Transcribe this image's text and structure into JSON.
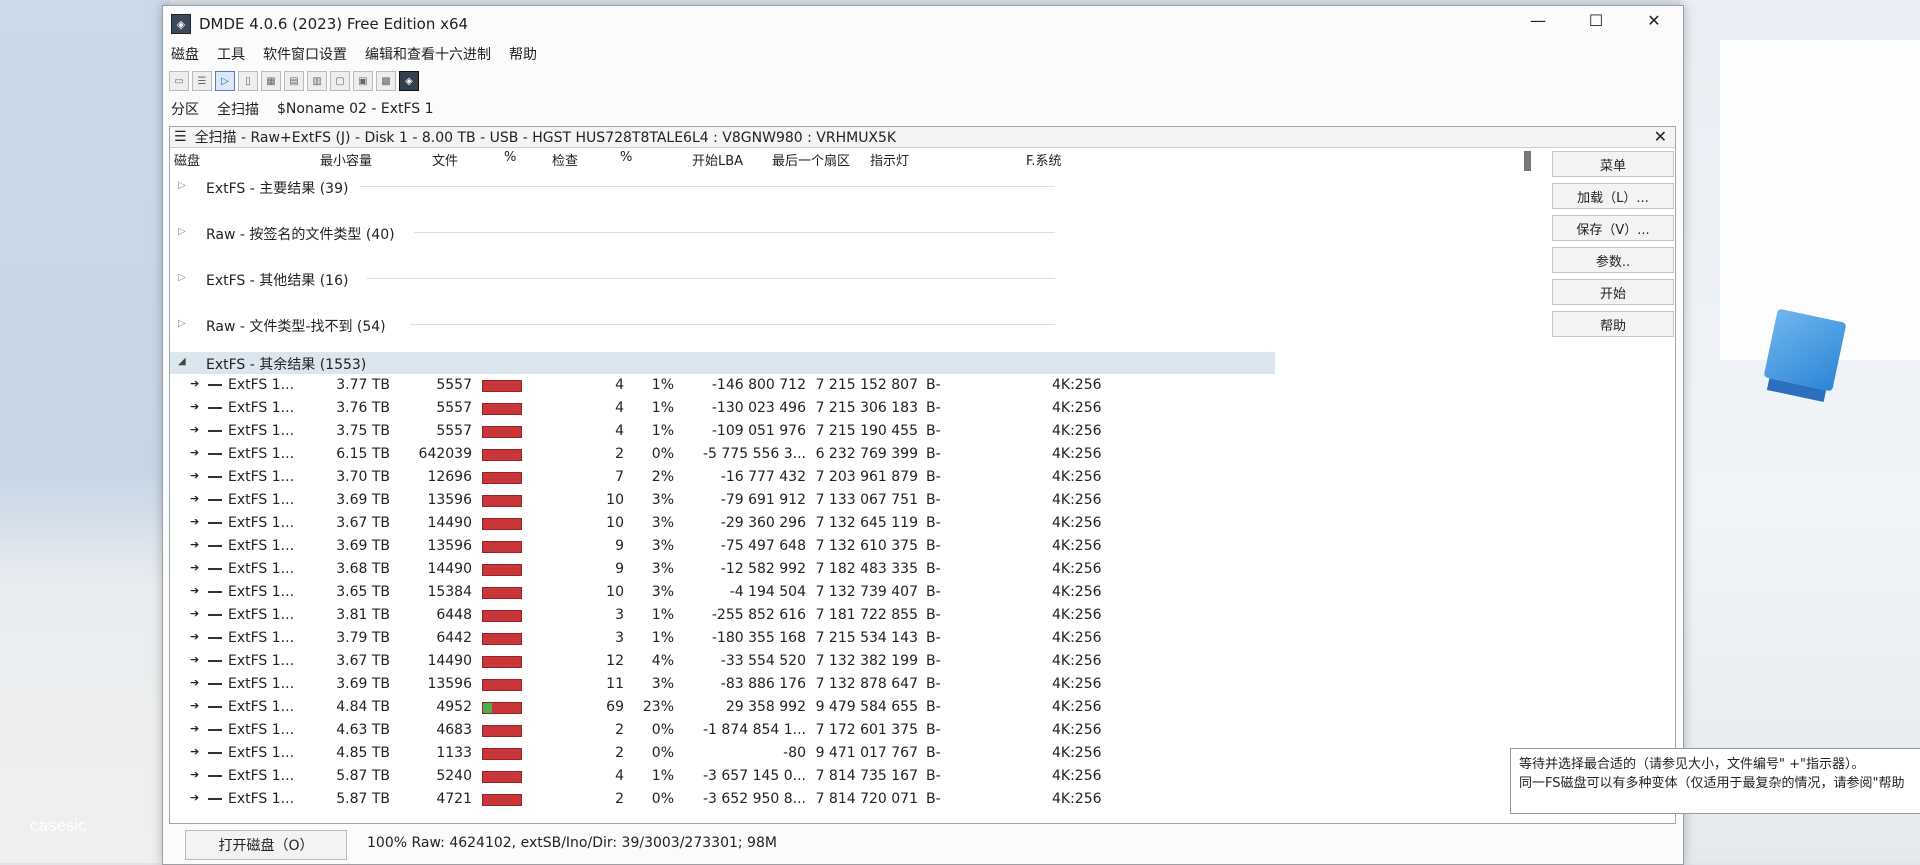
{
  "window": {
    "title": "DMDE 4.0.6 (2023) Free Edition x64",
    "app_icon": "dmde-logo-icon"
  },
  "menu": [
    "磁盘",
    "工具",
    "软件窗口设置",
    "编辑和查看十六进制",
    "帮助"
  ],
  "breadcrumb": {
    "partition_label": "分区",
    "scan_label": "全扫描",
    "volume": "$Noname 02 - ExtFS 1"
  },
  "panel": {
    "title": "全扫描 - Raw+ExtFS (J) - Disk 1 - 8.00 TB - USB - HGST HUS728T8TALE6L4 : V8GNW980 : VRHMUX5K"
  },
  "columns": {
    "disk": "磁盘",
    "min_size": "最小容量",
    "files": "文件",
    "pct1": "%",
    "check": "检查",
    "pct2": "%",
    "start_lba": "开始LBA",
    "last_sector": "最后一个扇区",
    "indicator": "指示灯",
    "fs": "F.系统"
  },
  "groups": [
    {
      "label": "ExtFS - 主要结果 (39)"
    },
    {
      "label": "Raw - 按签名的文件类型 (40)"
    },
    {
      "label": "ExtFS - 其他结果 (16)"
    },
    {
      "label": "Raw - 文件类型-找不到 (54)"
    },
    {
      "label": "ExtFS - 其余结果 (1553)"
    }
  ],
  "rows": [
    {
      "name": "ExtFS 1...",
      "size": "3.77 TB",
      "files": "5557",
      "check": "4",
      "pct": "1%",
      "start": "-146 800 712",
      "last": "7 215 152 807",
      "ind": "B-",
      "fs": "4K:256",
      "fill": 0
    },
    {
      "name": "ExtFS 1...",
      "size": "3.76 TB",
      "files": "5557",
      "check": "4",
      "pct": "1%",
      "start": "-130 023 496",
      "last": "7 215 306 183",
      "ind": "B-",
      "fs": "4K:256",
      "fill": 0
    },
    {
      "name": "ExtFS 1...",
      "size": "3.75 TB",
      "files": "5557",
      "check": "4",
      "pct": "1%",
      "start": "-109 051 976",
      "last": "7 215 190 455",
      "ind": "B-",
      "fs": "4K:256",
      "fill": 0
    },
    {
      "name": "ExtFS 1...",
      "size": "6.15 TB",
      "files": "642039",
      "check": "2",
      "pct": "0%",
      "start": "-5 775 556 3...",
      "last": "6 232 769 399",
      "ind": "B-",
      "fs": "4K:256",
      "fill": 0
    },
    {
      "name": "ExtFS 1...",
      "size": "3.70 TB",
      "files": "12696",
      "check": "7",
      "pct": "2%",
      "start": "-16 777 432",
      "last": "7 203 961 879",
      "ind": "B-",
      "fs": "4K:256",
      "fill": 0
    },
    {
      "name": "ExtFS 1...",
      "size": "3.69 TB",
      "files": "13596",
      "check": "10",
      "pct": "3%",
      "start": "-79 691 912",
      "last": "7 133 067 751",
      "ind": "B-",
      "fs": "4K:256",
      "fill": 0
    },
    {
      "name": "ExtFS 1...",
      "size": "3.67 TB",
      "files": "14490",
      "check": "10",
      "pct": "3%",
      "start": "-29 360 296",
      "last": "7 132 645 119",
      "ind": "B-",
      "fs": "4K:256",
      "fill": 0
    },
    {
      "name": "ExtFS 1...",
      "size": "3.69 TB",
      "files": "13596",
      "check": "9",
      "pct": "3%",
      "start": "-75 497 648",
      "last": "7 132 610 375",
      "ind": "B-",
      "fs": "4K:256",
      "fill": 0
    },
    {
      "name": "ExtFS 1...",
      "size": "3.68 TB",
      "files": "14490",
      "check": "9",
      "pct": "3%",
      "start": "-12 582 992",
      "last": "7 182 483 335",
      "ind": "B-",
      "fs": "4K:256",
      "fill": 0
    },
    {
      "name": "ExtFS 1...",
      "size": "3.65 TB",
      "files": "15384",
      "check": "10",
      "pct": "3%",
      "start": "-4 194 504",
      "last": "7 132 739 407",
      "ind": "B-",
      "fs": "4K:256",
      "fill": 0
    },
    {
      "name": "ExtFS 1...",
      "size": "3.81 TB",
      "files": "6448",
      "check": "3",
      "pct": "1%",
      "start": "-255 852 616",
      "last": "7 181 722 855",
      "ind": "B-",
      "fs": "4K:256",
      "fill": 0
    },
    {
      "name": "ExtFS 1...",
      "size": "3.79 TB",
      "files": "6442",
      "check": "3",
      "pct": "1%",
      "start": "-180 355 168",
      "last": "7 215 534 143",
      "ind": "B-",
      "fs": "4K:256",
      "fill": 0
    },
    {
      "name": "ExtFS 1...",
      "size": "3.67 TB",
      "files": "14490",
      "check": "12",
      "pct": "4%",
      "start": "-33 554 520",
      "last": "7 132 382 199",
      "ind": "B-",
      "fs": "4K:256",
      "fill": 0
    },
    {
      "name": "ExtFS 1...",
      "size": "3.69 TB",
      "files": "13596",
      "check": "11",
      "pct": "3%",
      "start": "-83 886 176",
      "last": "7 132 878 647",
      "ind": "B-",
      "fs": "4K:256",
      "fill": 0
    },
    {
      "name": "ExtFS 1...",
      "size": "4.84 TB",
      "files": "4952",
      "check": "69",
      "pct": "23%",
      "start": "29 358 992",
      "last": "9 479 584 655",
      "ind": "B-",
      "fs": "4K:256",
      "fill": 0.23
    },
    {
      "name": "ExtFS 1...",
      "size": "4.63 TB",
      "files": "4683",
      "check": "2",
      "pct": "0%",
      "start": "-1 874 854 1...",
      "last": "7 172 601 375",
      "ind": "B-",
      "fs": "4K:256",
      "fill": 0
    },
    {
      "name": "ExtFS 1...",
      "size": "4.85 TB",
      "files": "1133",
      "check": "2",
      "pct": "0%",
      "start": "-80",
      "last": "9 471 017 767",
      "ind": "B-",
      "fs": "4K:256",
      "fill": 0
    },
    {
      "name": "ExtFS 1...",
      "size": "5.87 TB",
      "files": "5240",
      "check": "4",
      "pct": "1%",
      "start": "-3 657 145 0...",
      "last": "7 814 735 167",
      "ind": "B-",
      "fs": "4K:256",
      "fill": 0
    },
    {
      "name": "ExtFS 1...",
      "size": "5.87 TB",
      "files": "4721",
      "check": "2",
      "pct": "0%",
      "start": "-3 652 950 8...",
      "last": "7 814 720 071",
      "ind": "B-",
      "fs": "4K:256",
      "fill": 0
    }
  ],
  "side_buttons": [
    "菜单",
    "加载（L）...",
    "保存（V）...",
    "参数..",
    "开始",
    "帮助"
  ],
  "tooltip": {
    "line1": "等待并选择最合适的（请参见大小，文件编号\" +\"指示器）。",
    "line2": "同一FS磁盘可以有多种变体（仅适用于最复杂的情况，请参阅\"帮助"
  },
  "status": {
    "open_button": "打开磁盘（O）",
    "text": "100% Raw: 4624102, extSB/Ino/Dir: 39/3003/273301; 98M"
  },
  "desktop_label": "casesic"
}
